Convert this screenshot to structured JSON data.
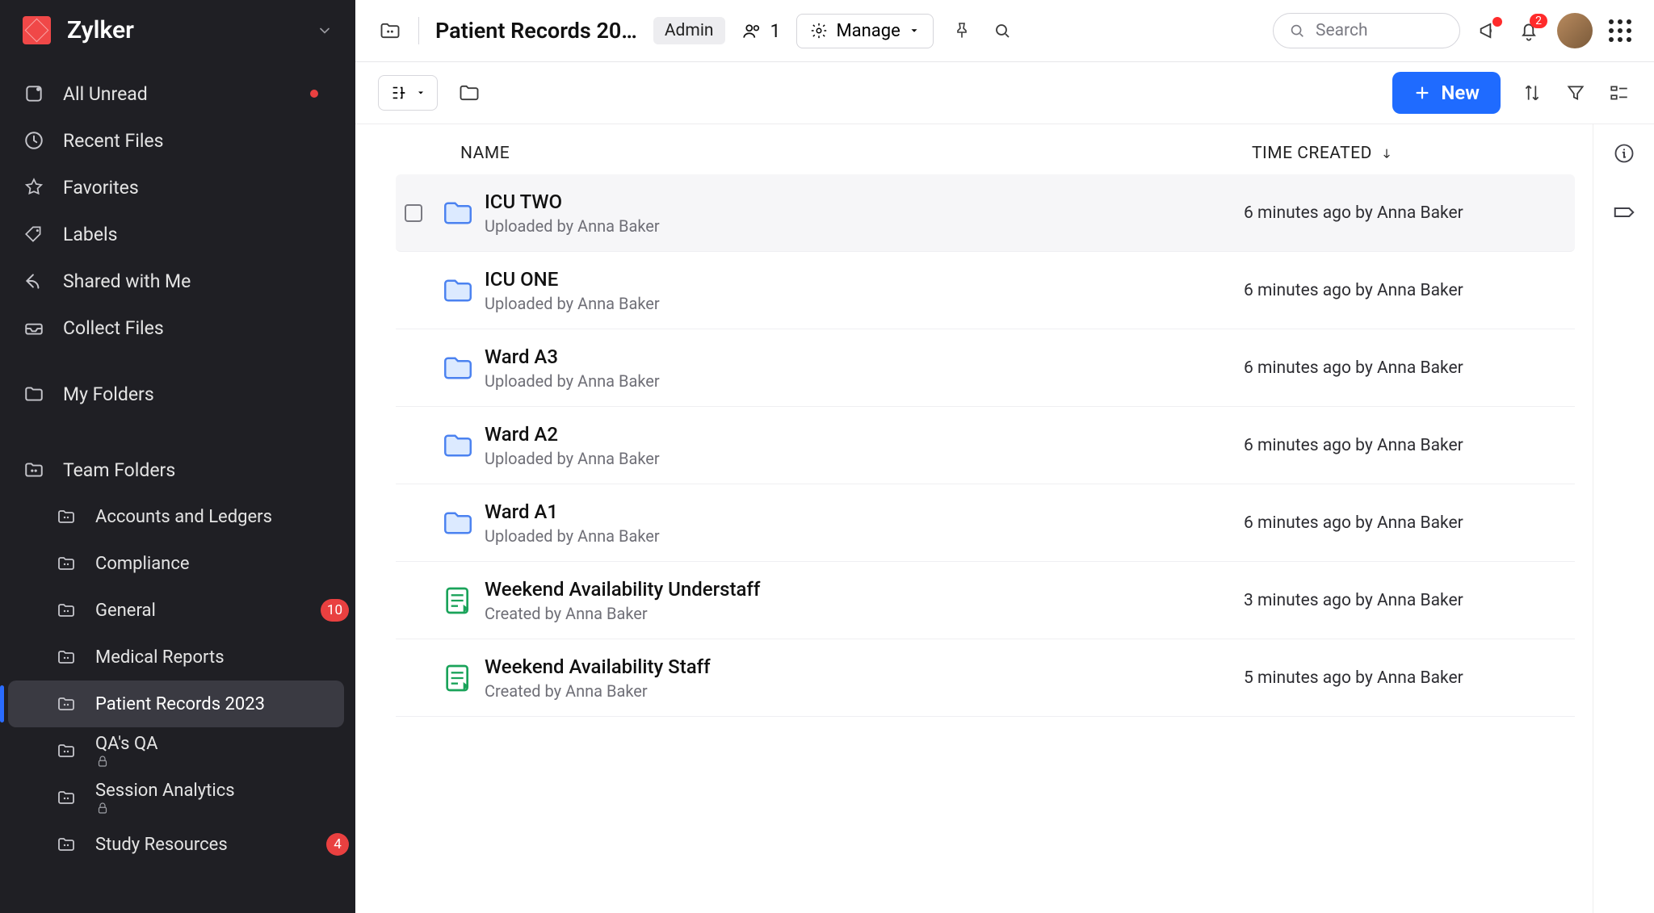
{
  "brand": "Zylker",
  "sidebar": {
    "nav": [
      {
        "label": "All Unread",
        "icon": "unread",
        "dot": true
      },
      {
        "label": "Recent Files",
        "icon": "clock"
      },
      {
        "label": "Favorites",
        "icon": "star"
      },
      {
        "label": "Labels",
        "icon": "tag"
      },
      {
        "label": "Shared with Me",
        "icon": "share"
      },
      {
        "label": "Collect Files",
        "icon": "inbox"
      }
    ],
    "myfolders_label": "My Folders",
    "teamfolders_label": "Team Folders",
    "teamfolders": [
      {
        "label": "Accounts and Ledgers"
      },
      {
        "label": "Compliance"
      },
      {
        "label": "General",
        "badge": "10"
      },
      {
        "label": "Medical Reports"
      },
      {
        "label": "Patient Records 2023",
        "active": true
      },
      {
        "label": "QA's QA",
        "lock": true
      },
      {
        "label": "Session Analytics",
        "lock": true
      },
      {
        "label": "Study Resources",
        "badge": "4"
      }
    ]
  },
  "header": {
    "title": "Patient Records 20…",
    "badge": "Admin",
    "peopleCount": "1",
    "manage_label": "Manage",
    "search_placeholder": "Search",
    "bell_badge": "2"
  },
  "toolbar": {
    "new_label": "New"
  },
  "columns": {
    "name": "NAME",
    "time": "TIME CREATED"
  },
  "files": [
    {
      "name": "ICU TWO",
      "sub": "Uploaded by Anna Baker",
      "time": "6 minutes ago by Anna Baker",
      "type": "folder",
      "hover": true
    },
    {
      "name": "ICU ONE",
      "sub": "Uploaded by Anna Baker",
      "time": "6 minutes ago by Anna Baker",
      "type": "folder"
    },
    {
      "name": "Ward A3",
      "sub": "Uploaded by Anna Baker",
      "time": "6 minutes ago by Anna Baker",
      "type": "folder"
    },
    {
      "name": "Ward A2",
      "sub": "Uploaded by Anna Baker",
      "time": "6 minutes ago by Anna Baker",
      "type": "folder"
    },
    {
      "name": "Ward A1",
      "sub": "Uploaded by Anna Baker",
      "time": "6 minutes ago by Anna Baker",
      "type": "folder"
    },
    {
      "name": "Weekend Availability Understaff",
      "sub": "Created by Anna Baker",
      "time": "3 minutes ago by Anna Baker",
      "type": "sheet"
    },
    {
      "name": "Weekend Availability Staff",
      "sub": "Created by Anna Baker",
      "time": "5 minutes ago by Anna Baker",
      "type": "sheet"
    }
  ]
}
